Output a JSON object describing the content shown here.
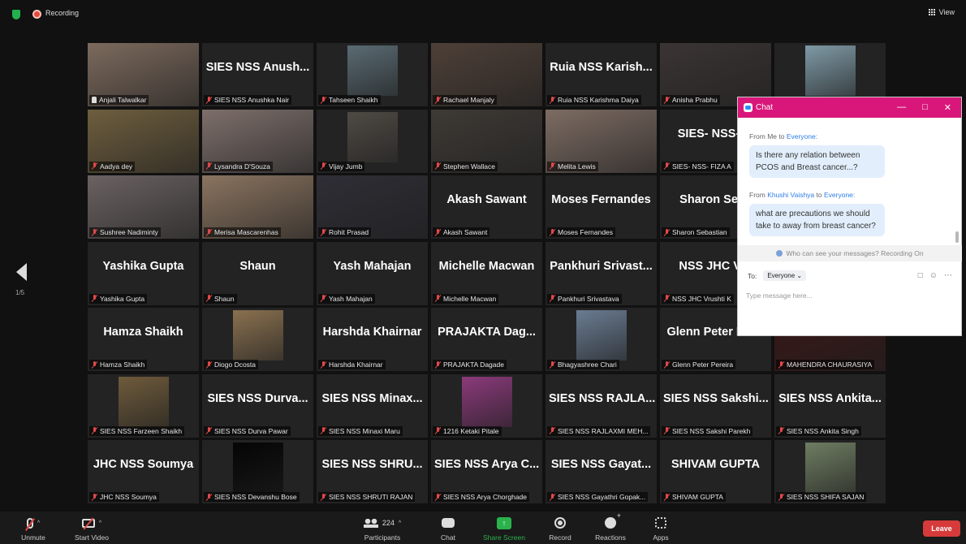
{
  "topbar": {
    "recording_label": "Recording",
    "view_label": "View"
  },
  "pager": {
    "page": "1/5"
  },
  "tiles": [
    {
      "label": "Anjali Talwalkar",
      "video": true,
      "pinned": true,
      "color": "#7c6a5d"
    },
    {
      "label": "SIES NSS Anushka Nair",
      "title": "SIES NSS Anush..."
    },
    {
      "label": "Tahseen Shaikh",
      "video": true,
      "small": true,
      "color": "#5a6b73"
    },
    {
      "label": "Rachael Manjaly",
      "video": true,
      "color": "#4e4038"
    },
    {
      "label": "Ruia NSS Karishma Daiya",
      "title": "Ruia NSS Karish..."
    },
    {
      "label": "Anisha Prabhu",
      "video": true,
      "color": "#3b3434"
    },
    {
      "label": "",
      "video": true,
      "small": true,
      "color": "#7f9aa6"
    },
    {
      "label": "Aadya dey",
      "video": true,
      "active": true,
      "color": "#6e5e3e"
    },
    {
      "label": "Lysandra D'Souza",
      "video": true,
      "color": "#7d6f6b"
    },
    {
      "label": "Vijay Jumb",
      "video": true,
      "small": true,
      "color": "#4f4a44"
    },
    {
      "label": "Stephen Wallace",
      "video": true,
      "color": "#3e3a35"
    },
    {
      "label": "Melita Lewis",
      "video": true,
      "color": "#7d6c63"
    },
    {
      "label": "SIES- NSS- FIZA A",
      "title": "SIES- NSS- FI"
    },
    {
      "label": "",
      "title": ""
    },
    {
      "label": "Sushree Nadiminty",
      "video": true,
      "color": "#6b6262"
    },
    {
      "label": "Merisa Mascarenhas",
      "video": true,
      "color": "#8a7460"
    },
    {
      "label": "Rohit Prasad",
      "video": true,
      "color": "#2f2e36"
    },
    {
      "label": "Akash Sawant",
      "title": "Akash Sawant"
    },
    {
      "label": "Moses Fernandes",
      "title": "Moses Fernandes"
    },
    {
      "label": "Sharon Sebastian",
      "title": "Sharon Seba"
    },
    {
      "label": "",
      "title": ""
    },
    {
      "label": "Yashika Gupta",
      "title": "Yashika Gupta"
    },
    {
      "label": "Shaun",
      "title": "Shaun"
    },
    {
      "label": "Yash Mahajan",
      "title": "Yash Mahajan"
    },
    {
      "label": "Michelle Macwan",
      "title": "Michelle Macwan"
    },
    {
      "label": "Pankhuri Srivastava",
      "title": "Pankhuri Srivast..."
    },
    {
      "label": "NSS JHC Vrushti K",
      "title": "NSS JHC Vru"
    },
    {
      "label": "",
      "title": ""
    },
    {
      "label": "Hamza Shaikh",
      "title": "Hamza Shaikh"
    },
    {
      "label": "Diogo Dcosta",
      "video": true,
      "small": true,
      "color": "#8a7150"
    },
    {
      "label": "Harshda Khairnar",
      "title": "Harshda Khairnar"
    },
    {
      "label": "PRAJAKTA Dagade",
      "title": "PRAJAKTA Dag..."
    },
    {
      "label": "Bhagyashree Chari",
      "video": true,
      "small": true,
      "color": "#6a7c92"
    },
    {
      "label": "Glenn Peter Pereira",
      "title": "Glenn Peter Per..."
    },
    {
      "label": "MAHENDRA CHAURASIYA",
      "video": true,
      "color": "#3a1717"
    },
    {
      "label": "SIES NSS Farzeen Shaikh",
      "video": true,
      "small": true,
      "color": "#6f5b3c"
    },
    {
      "label": "SIES NSS Durva Pawar",
      "title": "SIES NSS Durva..."
    },
    {
      "label": "SIES NSS Minaxi Maru",
      "title": "SIES NSS Minax..."
    },
    {
      "label": "1216 Ketaki Pitale",
      "video": true,
      "small": true,
      "color": "#8b3a7b"
    },
    {
      "label": "SIES NSS RAJLAXMI MEH...",
      "title": "SIES NSS RAJLA..."
    },
    {
      "label": "SIES NSS Sakshi Parekh",
      "title": "SIES NSS Sakshi..."
    },
    {
      "label": "SIES NSS Ankita Singh",
      "title": "SIES NSS Ankita..."
    },
    {
      "label": "JHC NSS Soumya",
      "title": "JHC NSS Soumya"
    },
    {
      "label": "SIES NSS Devanshu Bose",
      "video": true,
      "small": true,
      "color": "#050505"
    },
    {
      "label": "SIES NSS SHRUTI RAJAN",
      "title": "SIES NSS SHRU..."
    },
    {
      "label": "SIES NSS Arya Chorghade",
      "title": "SIES NSS Arya C..."
    },
    {
      "label": "SIES NSS Gayathri Gopak...",
      "title": "SIES NSS Gayat..."
    },
    {
      "label": "SHIVAM GUPTA",
      "title": "SHIVAM GUPTA"
    },
    {
      "label": "SIES NSS SHIFA SAJAN",
      "video": true,
      "small": true,
      "color": "#6f7d62"
    }
  ],
  "chat": {
    "title": "Chat",
    "messages": [
      {
        "from_prefix": "From Me to ",
        "to": "Everyone:",
        "text": "Is there any relation between PCOS and Breast cancer...?"
      },
      {
        "from_prefix": "From ",
        "sender": "Khushi Vaishya",
        "mid": " to ",
        "to": "Everyone:",
        "text": "what are precautions we should take to away from breast cancer?"
      }
    ],
    "who_can_see": "Who can see your messages? Recording On",
    "to_label": "To:",
    "to_value": "Everyone",
    "input_placeholder": "Type message here..."
  },
  "toolbar": {
    "unmute": "Unmute",
    "start_video": "Start Video",
    "participants": "Participants",
    "participants_count": "224",
    "chat": "Chat",
    "share_screen": "Share Screen",
    "record": "Record",
    "reactions": "Reactions",
    "apps": "Apps",
    "leave": "Leave"
  }
}
